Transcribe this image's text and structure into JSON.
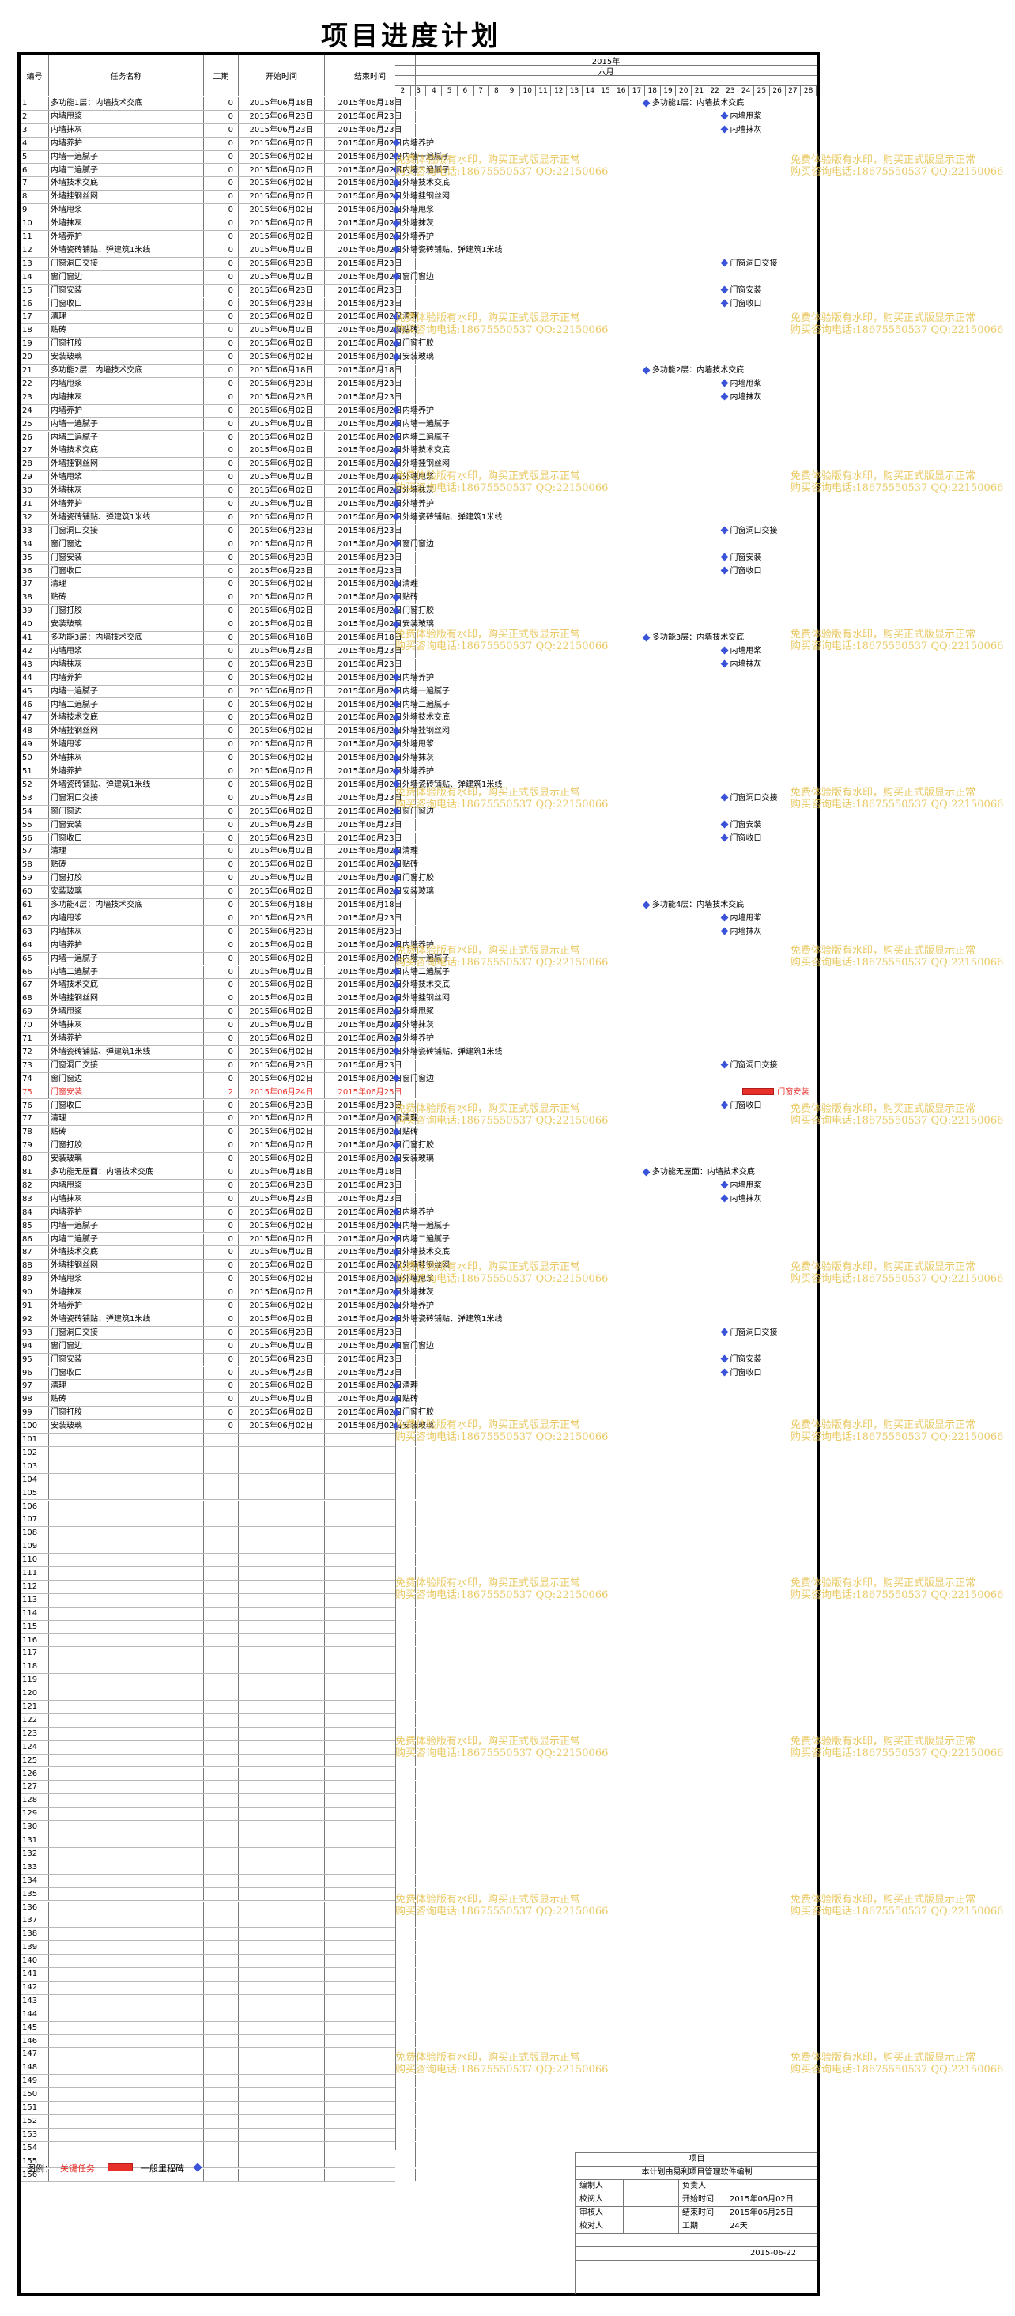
{
  "title": "项目进度计划",
  "header": {
    "id": "编号",
    "name": "任务名称",
    "duration": "工期",
    "start": "开始时间",
    "end": "结束时间",
    "year": "2015年",
    "month": "六月",
    "days": [
      "2",
      "3",
      "4",
      "5",
      "6",
      "7",
      "8",
      "9",
      "10",
      "11",
      "12",
      "13",
      "14",
      "15",
      "16",
      "17",
      "18",
      "19",
      "20",
      "21",
      "22",
      "23",
      "24",
      "25",
      "26",
      "27",
      "28"
    ]
  },
  "tasks": [
    {
      "id": "1",
      "name": "多功能1层：内墙技术交底",
      "dur": "0",
      "start": "2015年06月18日",
      "end": "2015年06月18日",
      "day": 18,
      "label": "多功能1层：内墙技术交底"
    },
    {
      "id": "2",
      "name": "内墙甩浆",
      "dur": "0",
      "start": "2015年06月23日",
      "end": "2015年06月23日",
      "day": 23,
      "label": "内墙甩浆"
    },
    {
      "id": "3",
      "name": "内墙抹灰",
      "dur": "0",
      "start": "2015年06月23日",
      "end": "2015年06月23日",
      "day": 23,
      "label": "内墙抹灰"
    },
    {
      "id": "4",
      "name": "内墙养护",
      "dur": "0",
      "start": "2015年06月02日",
      "end": "2015年06月02日",
      "day": 2,
      "label": "内墙养护"
    },
    {
      "id": "5",
      "name": "内墙一遍腻子",
      "dur": "0",
      "start": "2015年06月02日",
      "end": "2015年06月02日",
      "day": 2,
      "label": "内墙一遍腻子"
    },
    {
      "id": "6",
      "name": "内墙二遍腻子",
      "dur": "0",
      "start": "2015年06月02日",
      "end": "2015年06月02日",
      "day": 2,
      "label": "内墙二遍腻子"
    },
    {
      "id": "7",
      "name": "外墙技术交底",
      "dur": "0",
      "start": "2015年06月02日",
      "end": "2015年06月02日",
      "day": 2,
      "label": "外墙技术交底"
    },
    {
      "id": "8",
      "name": "外墙挂钢丝网",
      "dur": "0",
      "start": "2015年06月02日",
      "end": "2015年06月02日",
      "day": 2,
      "label": "外墙挂钢丝网"
    },
    {
      "id": "9",
      "name": "外墙甩浆",
      "dur": "0",
      "start": "2015年06月02日",
      "end": "2015年06月02日",
      "day": 2,
      "label": "外墙甩浆"
    },
    {
      "id": "10",
      "name": "外墙抹灰",
      "dur": "0",
      "start": "2015年06月02日",
      "end": "2015年06月02日",
      "day": 2,
      "label": "外墙抹灰"
    },
    {
      "id": "11",
      "name": "外墙养护",
      "dur": "0",
      "start": "2015年06月02日",
      "end": "2015年06月02日",
      "day": 2,
      "label": "外墙养护"
    },
    {
      "id": "12",
      "name": "外墙瓷砖铺贴、弹建筑1米线",
      "dur": "0",
      "start": "2015年06月02日",
      "end": "2015年06月02日",
      "day": 2,
      "label": "外墙瓷砖铺贴、弹建筑1米线"
    },
    {
      "id": "13",
      "name": "门窗洞口交接",
      "dur": "0",
      "start": "2015年06月23日",
      "end": "2015年06月23日",
      "day": 23,
      "label": "门窗洞口交接"
    },
    {
      "id": "14",
      "name": "窗门窗边",
      "dur": "0",
      "start": "2015年06月02日",
      "end": "2015年06月02日",
      "day": 2,
      "label": "窗门窗边"
    },
    {
      "id": "15",
      "name": "门窗安装",
      "dur": "0",
      "start": "2015年06月23日",
      "end": "2015年06月23日",
      "day": 23,
      "label": "门窗安装"
    },
    {
      "id": "16",
      "name": "门窗收口",
      "dur": "0",
      "start": "2015年06月23日",
      "end": "2015年06月23日",
      "day": 23,
      "label": "门窗收口"
    },
    {
      "id": "17",
      "name": "清理",
      "dur": "0",
      "start": "2015年06月02日",
      "end": "2015年06月02日",
      "day": 2,
      "label": "清理"
    },
    {
      "id": "18",
      "name": "贴砖",
      "dur": "0",
      "start": "2015年06月02日",
      "end": "2015年06月02日",
      "day": 2,
      "label": "贴砖"
    },
    {
      "id": "19",
      "name": "门窗打胶",
      "dur": "0",
      "start": "2015年06月02日",
      "end": "2015年06月02日",
      "day": 2,
      "label": "门窗打胶"
    },
    {
      "id": "20",
      "name": "安装玻璃",
      "dur": "0",
      "start": "2015年06月02日",
      "end": "2015年06月02日",
      "day": 2,
      "label": "安装玻璃"
    },
    {
      "id": "21",
      "name": "多功能2层：内墙技术交底",
      "dur": "0",
      "start": "2015年06月18日",
      "end": "2015年06月18日",
      "day": 18,
      "label": "多功能2层：内墙技术交底"
    },
    {
      "id": "22",
      "name": "内墙甩浆",
      "dur": "0",
      "start": "2015年06月23日",
      "end": "2015年06月23日",
      "day": 23,
      "label": "内墙甩浆"
    },
    {
      "id": "23",
      "name": "内墙抹灰",
      "dur": "0",
      "start": "2015年06月23日",
      "end": "2015年06月23日",
      "day": 23,
      "label": "内墙抹灰"
    },
    {
      "id": "24",
      "name": "内墙养护",
      "dur": "0",
      "start": "2015年06月02日",
      "end": "2015年06月02日",
      "day": 2,
      "label": "内墙养护"
    },
    {
      "id": "25",
      "name": "内墙一遍腻子",
      "dur": "0",
      "start": "2015年06月02日",
      "end": "2015年06月02日",
      "day": 2,
      "label": "内墙一遍腻子"
    },
    {
      "id": "26",
      "name": "内墙二遍腻子",
      "dur": "0",
      "start": "2015年06月02日",
      "end": "2015年06月02日",
      "day": 2,
      "label": "内墙二遍腻子"
    },
    {
      "id": "27",
      "name": "外墙技术交底",
      "dur": "0",
      "start": "2015年06月02日",
      "end": "2015年06月02日",
      "day": 2,
      "label": "外墙技术交底"
    },
    {
      "id": "28",
      "name": "外墙挂钢丝网",
      "dur": "0",
      "start": "2015年06月02日",
      "end": "2015年06月02日",
      "day": 2,
      "label": "外墙挂钢丝网"
    },
    {
      "id": "29",
      "name": "外墙甩浆",
      "dur": "0",
      "start": "2015年06月02日",
      "end": "2015年06月02日",
      "day": 2,
      "label": "外墙甩浆"
    },
    {
      "id": "30",
      "name": "外墙抹灰",
      "dur": "0",
      "start": "2015年06月02日",
      "end": "2015年06月02日",
      "day": 2,
      "label": "外墙抹灰"
    },
    {
      "id": "31",
      "name": "外墙养护",
      "dur": "0",
      "start": "2015年06月02日",
      "end": "2015年06月02日",
      "day": 2,
      "label": "外墙养护"
    },
    {
      "id": "32",
      "name": "外墙瓷砖铺贴、弹建筑1米线",
      "dur": "0",
      "start": "2015年06月02日",
      "end": "2015年06月02日",
      "day": 2,
      "label": "外墙瓷砖铺贴、弹建筑1米线"
    },
    {
      "id": "33",
      "name": "门窗洞口交接",
      "dur": "0",
      "start": "2015年06月23日",
      "end": "2015年06月23日",
      "day": 23,
      "label": "门窗洞口交接"
    },
    {
      "id": "34",
      "name": "窗门窗边",
      "dur": "0",
      "start": "2015年06月02日",
      "end": "2015年06月02日",
      "day": 2,
      "label": "窗门窗边"
    },
    {
      "id": "35",
      "name": "门窗安装",
      "dur": "0",
      "start": "2015年06月23日",
      "end": "2015年06月23日",
      "day": 23,
      "label": "门窗安装"
    },
    {
      "id": "36",
      "name": "门窗收口",
      "dur": "0",
      "start": "2015年06月23日",
      "end": "2015年06月23日",
      "day": 23,
      "label": "门窗收口"
    },
    {
      "id": "37",
      "name": "清理",
      "dur": "0",
      "start": "2015年06月02日",
      "end": "2015年06月02日",
      "day": 2,
      "label": "清理"
    },
    {
      "id": "38",
      "name": "贴砖",
      "dur": "0",
      "start": "2015年06月02日",
      "end": "2015年06月02日",
      "day": 2,
      "label": "贴砖"
    },
    {
      "id": "39",
      "name": "门窗打胶",
      "dur": "0",
      "start": "2015年06月02日",
      "end": "2015年06月02日",
      "day": 2,
      "label": "门窗打胶"
    },
    {
      "id": "40",
      "name": "安装玻璃",
      "dur": "0",
      "start": "2015年06月02日",
      "end": "2015年06月02日",
      "day": 2,
      "label": "安装玻璃"
    },
    {
      "id": "41",
      "name": "多功能3层：内墙技术交底",
      "dur": "0",
      "start": "2015年06月18日",
      "end": "2015年06月18日",
      "day": 18,
      "label": "多功能3层：内墙技术交底"
    },
    {
      "id": "42",
      "name": "内墙甩浆",
      "dur": "0",
      "start": "2015年06月23日",
      "end": "2015年06月23日",
      "day": 23,
      "label": "内墙甩浆"
    },
    {
      "id": "43",
      "name": "内墙抹灰",
      "dur": "0",
      "start": "2015年06月23日",
      "end": "2015年06月23日",
      "day": 23,
      "label": "内墙抹灰"
    },
    {
      "id": "44",
      "name": "内墙养护",
      "dur": "0",
      "start": "2015年06月02日",
      "end": "2015年06月02日",
      "day": 2,
      "label": "内墙养护"
    },
    {
      "id": "45",
      "name": "内墙一遍腻子",
      "dur": "0",
      "start": "2015年06月02日",
      "end": "2015年06月02日",
      "day": 2,
      "label": "内墙一遍腻子"
    },
    {
      "id": "46",
      "name": "内墙二遍腻子",
      "dur": "0",
      "start": "2015年06月02日",
      "end": "2015年06月02日",
      "day": 2,
      "label": "内墙二遍腻子"
    },
    {
      "id": "47",
      "name": "外墙技术交底",
      "dur": "0",
      "start": "2015年06月02日",
      "end": "2015年06月02日",
      "day": 2,
      "label": "外墙技术交底"
    },
    {
      "id": "48",
      "name": "外墙挂钢丝网",
      "dur": "0",
      "start": "2015年06月02日",
      "end": "2015年06月02日",
      "day": 2,
      "label": "外墙挂钢丝网"
    },
    {
      "id": "49",
      "name": "外墙甩浆",
      "dur": "0",
      "start": "2015年06月02日",
      "end": "2015年06月02日",
      "day": 2,
      "label": "外墙甩浆"
    },
    {
      "id": "50",
      "name": "外墙抹灰",
      "dur": "0",
      "start": "2015年06月02日",
      "end": "2015年06月02日",
      "day": 2,
      "label": "外墙抹灰"
    },
    {
      "id": "51",
      "name": "外墙养护",
      "dur": "0",
      "start": "2015年06月02日",
      "end": "2015年06月02日",
      "day": 2,
      "label": "外墙养护"
    },
    {
      "id": "52",
      "name": "外墙瓷砖铺贴、弹建筑1米线",
      "dur": "0",
      "start": "2015年06月02日",
      "end": "2015年06月02日",
      "day": 2,
      "label": "外墙瓷砖铺贴、弹建筑1米线"
    },
    {
      "id": "53",
      "name": "门窗洞口交接",
      "dur": "0",
      "start": "2015年06月23日",
      "end": "2015年06月23日",
      "day": 23,
      "label": "门窗洞口交接"
    },
    {
      "id": "54",
      "name": "窗门窗边",
      "dur": "0",
      "start": "2015年06月02日",
      "end": "2015年06月02日",
      "day": 2,
      "label": "窗门窗边"
    },
    {
      "id": "55",
      "name": "门窗安装",
      "dur": "0",
      "start": "2015年06月23日",
      "end": "2015年06月23日",
      "day": 23,
      "label": "门窗安装"
    },
    {
      "id": "56",
      "name": "门窗收口",
      "dur": "0",
      "start": "2015年06月23日",
      "end": "2015年06月23日",
      "day": 23,
      "label": "门窗收口"
    },
    {
      "id": "57",
      "name": "清理",
      "dur": "0",
      "start": "2015年06月02日",
      "end": "2015年06月02日",
      "day": 2,
      "label": "清理"
    },
    {
      "id": "58",
      "name": "贴砖",
      "dur": "0",
      "start": "2015年06月02日",
      "end": "2015年06月02日",
      "day": 2,
      "label": "贴砖"
    },
    {
      "id": "59",
      "name": "门窗打胶",
      "dur": "0",
      "start": "2015年06月02日",
      "end": "2015年06月02日",
      "day": 2,
      "label": "门窗打胶"
    },
    {
      "id": "60",
      "name": "安装玻璃",
      "dur": "0",
      "start": "2015年06月02日",
      "end": "2015年06月02日",
      "day": 2,
      "label": "安装玻璃"
    },
    {
      "id": "61",
      "name": "多功能4层：内墙技术交底",
      "dur": "0",
      "start": "2015年06月18日",
      "end": "2015年06月18日",
      "day": 18,
      "label": "多功能4层：内墙技术交底"
    },
    {
      "id": "62",
      "name": "内墙甩浆",
      "dur": "0",
      "start": "2015年06月23日",
      "end": "2015年06月23日",
      "day": 23,
      "label": "内墙甩浆"
    },
    {
      "id": "63",
      "name": "内墙抹灰",
      "dur": "0",
      "start": "2015年06月23日",
      "end": "2015年06月23日",
      "day": 23,
      "label": "内墙抹灰"
    },
    {
      "id": "64",
      "name": "内墙养护",
      "dur": "0",
      "start": "2015年06月02日",
      "end": "2015年06月02日",
      "day": 2,
      "label": "内墙养护"
    },
    {
      "id": "65",
      "name": "内墙一遍腻子",
      "dur": "0",
      "start": "2015年06月02日",
      "end": "2015年06月02日",
      "day": 2,
      "label": "内墙一遍腻子"
    },
    {
      "id": "66",
      "name": "内墙二遍腻子",
      "dur": "0",
      "start": "2015年06月02日",
      "end": "2015年06月02日",
      "day": 2,
      "label": "内墙二遍腻子"
    },
    {
      "id": "67",
      "name": "外墙技术交底",
      "dur": "0",
      "start": "2015年06月02日",
      "end": "2015年06月02日",
      "day": 2,
      "label": "外墙技术交底"
    },
    {
      "id": "68",
      "name": "外墙挂钢丝网",
      "dur": "0",
      "start": "2015年06月02日",
      "end": "2015年06月02日",
      "day": 2,
      "label": "外墙挂钢丝网"
    },
    {
      "id": "69",
      "name": "外墙甩浆",
      "dur": "0",
      "start": "2015年06月02日",
      "end": "2015年06月02日",
      "day": 2,
      "label": "外墙甩浆"
    },
    {
      "id": "70",
      "name": "外墙抹灰",
      "dur": "0",
      "start": "2015年06月02日",
      "end": "2015年06月02日",
      "day": 2,
      "label": "外墙抹灰"
    },
    {
      "id": "71",
      "name": "外墙养护",
      "dur": "0",
      "start": "2015年06月02日",
      "end": "2015年06月02日",
      "day": 2,
      "label": "外墙养护"
    },
    {
      "id": "72",
      "name": "外墙瓷砖铺贴、弹建筑1米线",
      "dur": "0",
      "start": "2015年06月02日",
      "end": "2015年06月02日",
      "day": 2,
      "label": "外墙瓷砖铺贴、弹建筑1米线"
    },
    {
      "id": "73",
      "name": "门窗洞口交接",
      "dur": "0",
      "start": "2015年06月23日",
      "end": "2015年06月23日",
      "day": 23,
      "label": "门窗洞口交接"
    },
    {
      "id": "74",
      "name": "窗门窗边",
      "dur": "0",
      "start": "2015年06月02日",
      "end": "2015年06月02日",
      "day": 2,
      "label": "窗门窗边"
    },
    {
      "id": "75",
      "name": "门窗安装",
      "dur": "2",
      "start": "2015年06月24日",
      "end": "2015年06月25日",
      "day": 24,
      "label": "门窗安装",
      "critical": true
    },
    {
      "id": "76",
      "name": "门窗收口",
      "dur": "0",
      "start": "2015年06月23日",
      "end": "2015年06月23日",
      "day": 23,
      "label": "门窗收口"
    },
    {
      "id": "77",
      "name": "清理",
      "dur": "0",
      "start": "2015年06月02日",
      "end": "2015年06月02日",
      "day": 2,
      "label": "清理"
    },
    {
      "id": "78",
      "name": "贴砖",
      "dur": "0",
      "start": "2015年06月02日",
      "end": "2015年06月02日",
      "day": 2,
      "label": "贴砖"
    },
    {
      "id": "79",
      "name": "门窗打胶",
      "dur": "0",
      "start": "2015年06月02日",
      "end": "2015年06月02日",
      "day": 2,
      "label": "门窗打胶"
    },
    {
      "id": "80",
      "name": "安装玻璃",
      "dur": "0",
      "start": "2015年06月02日",
      "end": "2015年06月02日",
      "day": 2,
      "label": "安装玻璃"
    },
    {
      "id": "81",
      "name": "多功能无屋面：内墙技术交底",
      "dur": "0",
      "start": "2015年06月18日",
      "end": "2015年06月18日",
      "day": 18,
      "label": "多功能无屋面：内墙技术交底"
    },
    {
      "id": "82",
      "name": "内墙甩浆",
      "dur": "0",
      "start": "2015年06月23日",
      "end": "2015年06月23日",
      "day": 23,
      "label": "内墙甩浆"
    },
    {
      "id": "83",
      "name": "内墙抹灰",
      "dur": "0",
      "start": "2015年06月23日",
      "end": "2015年06月23日",
      "day": 23,
      "label": "内墙抹灰"
    },
    {
      "id": "84",
      "name": "内墙养护",
      "dur": "0",
      "start": "2015年06月02日",
      "end": "2015年06月02日",
      "day": 2,
      "label": "内墙养护"
    },
    {
      "id": "85",
      "name": "内墙一遍腻子",
      "dur": "0",
      "start": "2015年06月02日",
      "end": "2015年06月02日",
      "day": 2,
      "label": "内墙一遍腻子"
    },
    {
      "id": "86",
      "name": "内墙二遍腻子",
      "dur": "0",
      "start": "2015年06月02日",
      "end": "2015年06月02日",
      "day": 2,
      "label": "内墙二遍腻子"
    },
    {
      "id": "87",
      "name": "外墙技术交底",
      "dur": "0",
      "start": "2015年06月02日",
      "end": "2015年06月02日",
      "day": 2,
      "label": "外墙技术交底"
    },
    {
      "id": "88",
      "name": "外墙挂钢丝网",
      "dur": "0",
      "start": "2015年06月02日",
      "end": "2015年06月02日",
      "day": 2,
      "label": "外墙挂钢丝网"
    },
    {
      "id": "89",
      "name": "外墙甩浆",
      "dur": "0",
      "start": "2015年06月02日",
      "end": "2015年06月02日",
      "day": 2,
      "label": "外墙甩浆"
    },
    {
      "id": "90",
      "name": "外墙抹灰",
      "dur": "0",
      "start": "2015年06月02日",
      "end": "2015年06月02日",
      "day": 2,
      "label": "外墙抹灰"
    },
    {
      "id": "91",
      "name": "外墙养护",
      "dur": "0",
      "start": "2015年06月02日",
      "end": "2015年06月02日",
      "day": 2,
      "label": "外墙养护"
    },
    {
      "id": "92",
      "name": "外墙瓷砖铺贴、弹建筑1米线",
      "dur": "0",
      "start": "2015年06月02日",
      "end": "2015年06月02日",
      "day": 2,
      "label": "外墙瓷砖铺贴、弹建筑1米线"
    },
    {
      "id": "93",
      "name": "门窗洞口交接",
      "dur": "0",
      "start": "2015年06月23日",
      "end": "2015年06月23日",
      "day": 23,
      "label": "门窗洞口交接"
    },
    {
      "id": "94",
      "name": "窗门窗边",
      "dur": "0",
      "start": "2015年06月02日",
      "end": "2015年06月02日",
      "day": 2,
      "label": "窗门窗边"
    },
    {
      "id": "95",
      "name": "门窗安装",
      "dur": "0",
      "start": "2015年06月23日",
      "end": "2015年06月23日",
      "day": 23,
      "label": "门窗安装"
    },
    {
      "id": "96",
      "name": "门窗收口",
      "dur": "0",
      "start": "2015年06月23日",
      "end": "2015年06月23日",
      "day": 23,
      "label": "门窗收口"
    },
    {
      "id": "97",
      "name": "清理",
      "dur": "0",
      "start": "2015年06月02日",
      "end": "2015年06月02日",
      "day": 2,
      "label": "清理"
    },
    {
      "id": "98",
      "name": "贴砖",
      "dur": "0",
      "start": "2015年06月02日",
      "end": "2015年06月02日",
      "day": 2,
      "label": "贴砖"
    },
    {
      "id": "99",
      "name": "门窗打胶",
      "dur": "0",
      "start": "2015年06月02日",
      "end": "2015年06月02日",
      "day": 2,
      "label": "门窗打胶"
    },
    {
      "id": "100",
      "name": "安装玻璃",
      "dur": "0",
      "start": "2015年06月02日",
      "end": "2015年06月02日",
      "day": 2,
      "label": "安装玻璃"
    }
  ],
  "empty_rows": {
    "from": 101,
    "to": 156
  },
  "watermark": {
    "line1": "免费体验版有水印，购买正式版显示正常",
    "line2": "购买咨询电话:18675550537 QQ:22150066"
  },
  "legend": {
    "label": "图例：",
    "critical": "关键任务",
    "milestone": "一般里程碑"
  },
  "info": {
    "project": "项目",
    "note": "本计划由易利项目管理软件编制",
    "rows": [
      {
        "k1": "编制人",
        "v1": "",
        "k2": "负责人",
        "v2": ""
      },
      {
        "k1": "校阅人",
        "v1": "",
        "k2": "开始时间",
        "v2": "2015年06月02日"
      },
      {
        "k1": "审核人",
        "v1": "",
        "k2": "结束时间",
        "v2": "2015年06月25日"
      },
      {
        "k1": "校对人",
        "v1": "",
        "k2": "工期",
        "v2": "24天"
      }
    ],
    "date": "2015-06-22"
  },
  "colors": {
    "critical": "#e8302b",
    "milestone": "#3b53d8",
    "watermark": "#e7c04a"
  }
}
